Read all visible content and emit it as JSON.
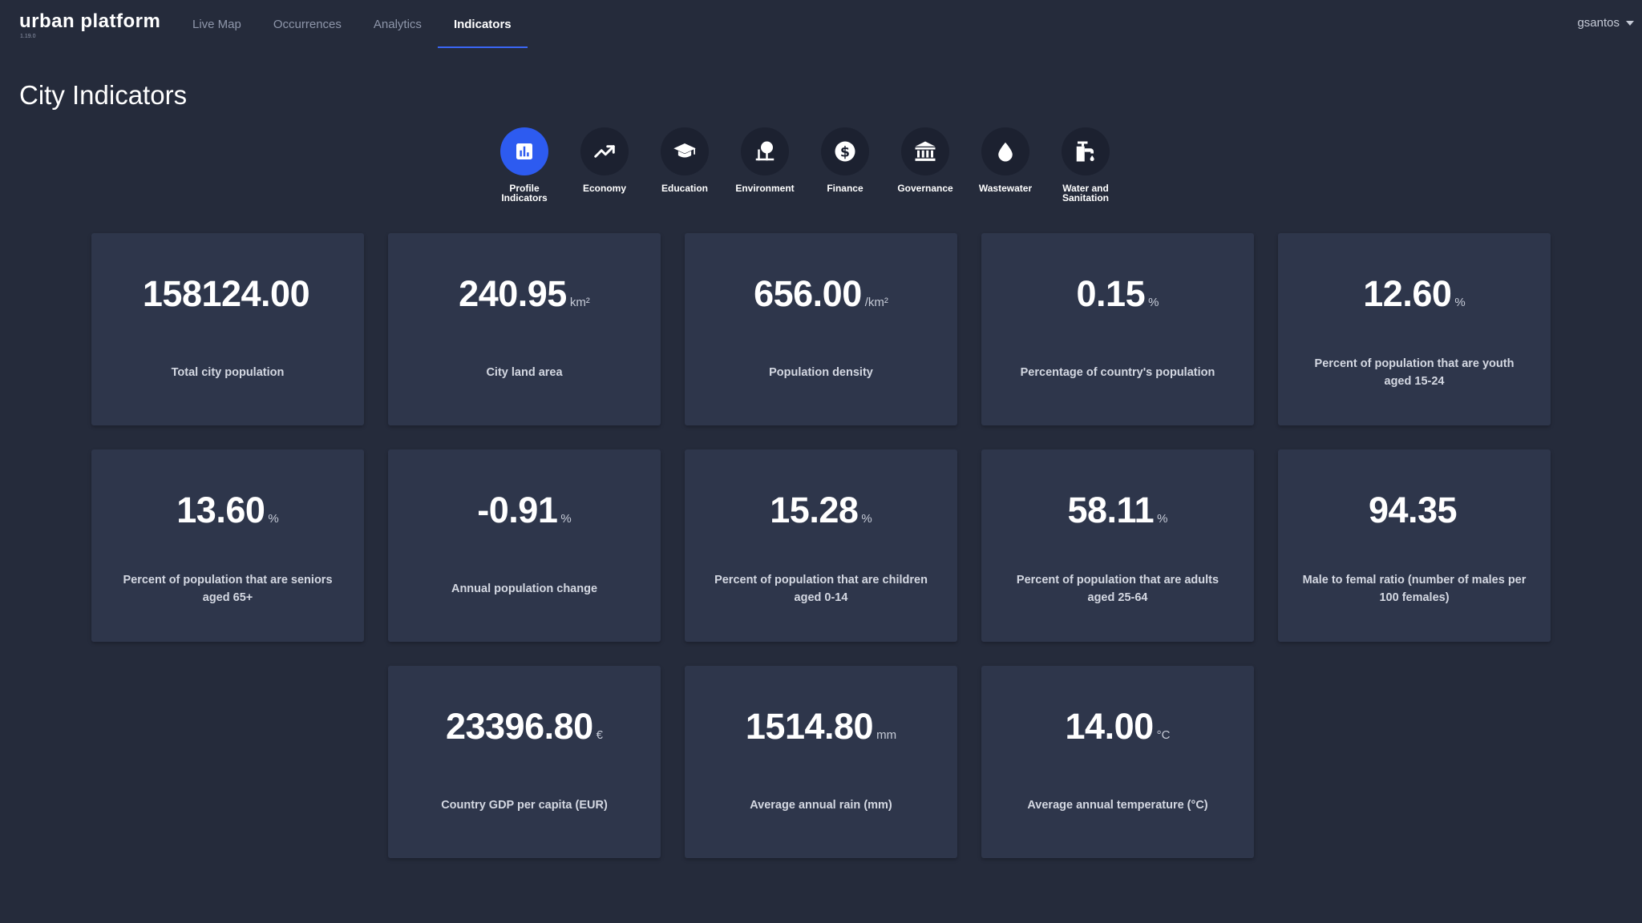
{
  "app": {
    "name": "urban platform",
    "version": "1.19.0"
  },
  "nav": {
    "tabs": [
      {
        "label": "Live Map"
      },
      {
        "label": "Occurrences"
      },
      {
        "label": "Analytics"
      },
      {
        "label": "Indicators",
        "active": true
      }
    ]
  },
  "user": {
    "name": "gsantos"
  },
  "page": {
    "title": "City Indicators"
  },
  "categories": [
    {
      "label": "Profile Indicators",
      "icon": "bar-chart-icon",
      "active": true
    },
    {
      "label": "Economy",
      "icon": "trending-up-icon"
    },
    {
      "label": "Education",
      "icon": "graduation-cap-icon"
    },
    {
      "label": "Environment",
      "icon": "tree-icon"
    },
    {
      "label": "Finance",
      "icon": "dollar-icon"
    },
    {
      "label": "Governance",
      "icon": "institution-icon"
    },
    {
      "label": "Wastewater",
      "icon": "water-drop-icon"
    },
    {
      "label": "Water and Sanitation",
      "icon": "faucet-icon"
    }
  ],
  "colors": {
    "background": "#252b3b",
    "card": "#2e364b",
    "accent": "#2d5bf0",
    "muted_text": "#8e96aa"
  },
  "indicators": [
    {
      "value": "158124.00",
      "unit": "",
      "label": "Total city population"
    },
    {
      "value": "240.95",
      "unit": "km²",
      "label": "City land area"
    },
    {
      "value": "656.00",
      "unit": "/km²",
      "label": "Population density"
    },
    {
      "value": "0.15",
      "unit": "%",
      "label": "Percentage of country's population"
    },
    {
      "value": "12.60",
      "unit": "%",
      "label": "Percent of population that are youth aged 15-24"
    },
    {
      "value": "13.60",
      "unit": "%",
      "label": "Percent of population that are seniors aged 65+"
    },
    {
      "value": "-0.91",
      "unit": "%",
      "label": "Annual population change"
    },
    {
      "value": "15.28",
      "unit": "%",
      "label": "Percent of population that are children aged 0-14"
    },
    {
      "value": "58.11",
      "unit": "%",
      "label": "Percent of population that are adults aged 25-64"
    },
    {
      "value": "94.35",
      "unit": "",
      "label": "Male to femal ratio (number of males per 100 females)"
    },
    {
      "value": "23396.80",
      "unit": "€",
      "label": "Country GDP per capita (EUR)"
    },
    {
      "value": "1514.80",
      "unit": "mm",
      "label": "Average annual rain (mm)"
    },
    {
      "value": "14.00",
      "unit": "°C",
      "label": "Average annual temperature (°C)"
    }
  ]
}
